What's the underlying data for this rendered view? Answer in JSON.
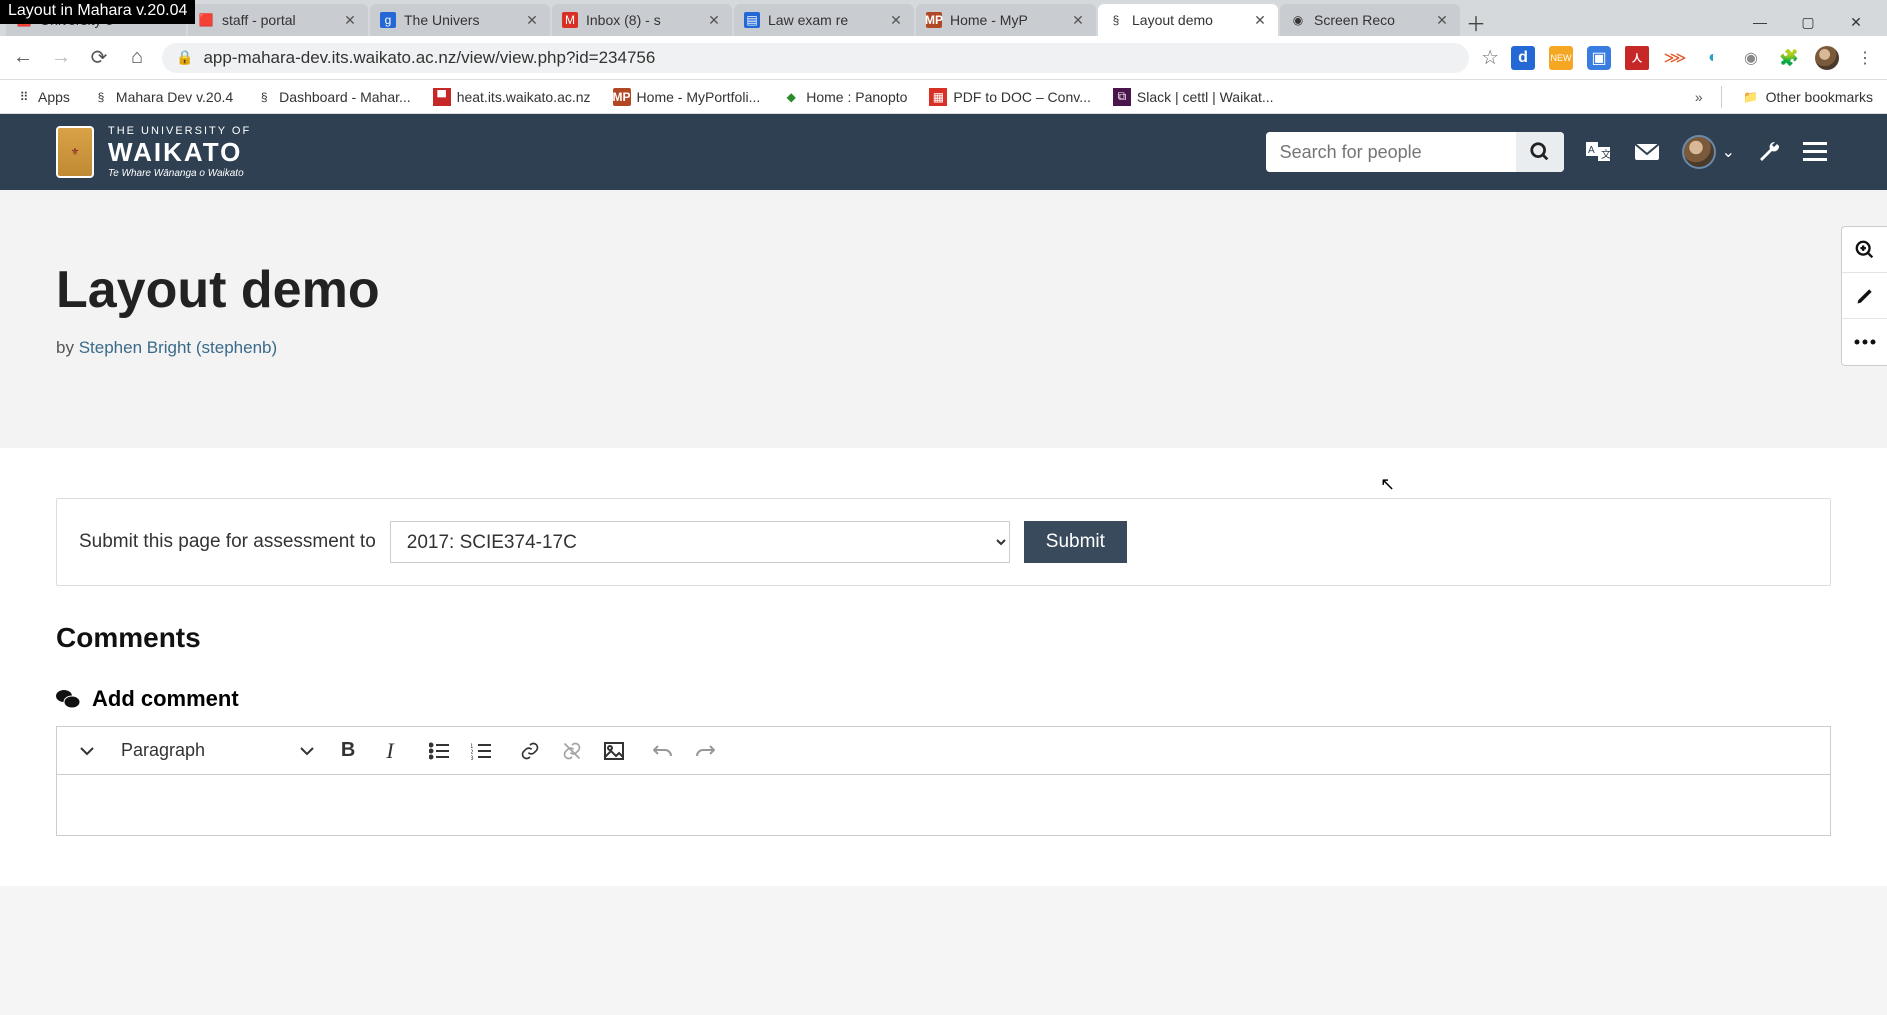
{
  "window_title": "Layout in Mahara v.20.04",
  "tabs": [
    {
      "title": "University o"
    },
    {
      "title": "staff - portal"
    },
    {
      "title": "The Univers"
    },
    {
      "title": "Inbox (8) - s"
    },
    {
      "title": "Law exam re"
    },
    {
      "title": "Home - MyP"
    },
    {
      "title": "Layout demo"
    },
    {
      "title": "Screen Reco"
    }
  ],
  "url": "app-mahara-dev.its.waikato.ac.nz/view/view.php?id=234756",
  "bookmarks": [
    {
      "label": "Apps"
    },
    {
      "label": "Mahara Dev v.20.4"
    },
    {
      "label": "Dashboard - Mahar..."
    },
    {
      "label": "heat.its.waikato.ac.nz"
    },
    {
      "label": "Home - MyPortfoli..."
    },
    {
      "label": "Home : Panopto"
    },
    {
      "label": "PDF to DOC – Conv..."
    },
    {
      "label": "Slack | cettl | Waikat..."
    }
  ],
  "other_bookmarks_label": "Other bookmarks",
  "brand": {
    "line1": "THE UNIVERSITY OF",
    "line2": "WAIKATO",
    "line3": "Te Whare Wānanga o Waikato"
  },
  "search_placeholder": "Search for people",
  "page": {
    "title": "Layout demo",
    "byline_prefix": "by ",
    "byline_author": "Stephen Bright (stephenb)"
  },
  "submit": {
    "label": "Submit this page for assessment to",
    "selected": "2017: SCIE374-17C",
    "button": "Submit"
  },
  "comments": {
    "heading": "Comments",
    "add_label": "Add comment",
    "format_select": "Paragraph"
  }
}
